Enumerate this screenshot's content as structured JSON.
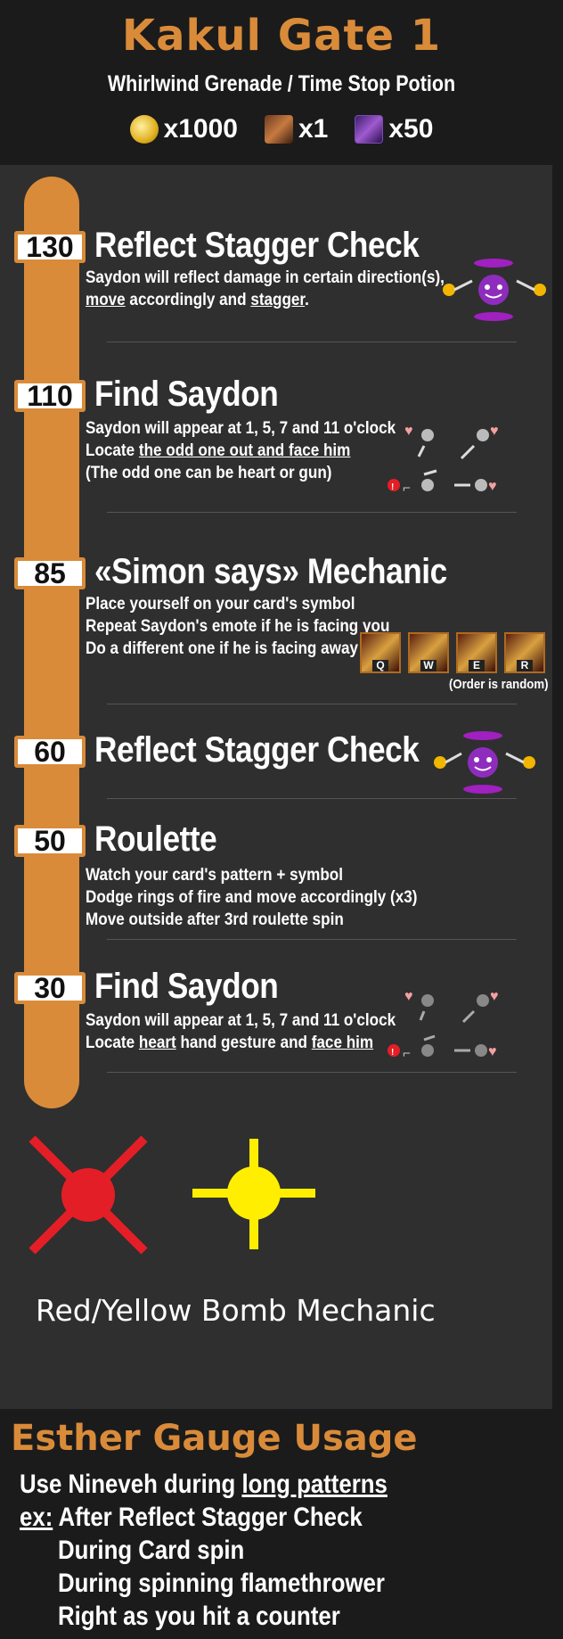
{
  "header": {
    "title": "Kakul Gate 1",
    "subtitle": "Whirlwind Grenade / Time Stop Potion",
    "rewards": [
      {
        "icon": "gold-coin-icon",
        "amount": "x1000"
      },
      {
        "icon": "leapstone-icon",
        "amount": "x1"
      },
      {
        "icon": "chest-icon",
        "amount": "x50"
      }
    ]
  },
  "sections": [
    {
      "hp": "130",
      "title": "Reflect Stagger Check",
      "lines": [
        [
          "Saydon will reflect damage in certain direction(s),"
        ],
        [
          "move",
          " accordingly and ",
          "stagger",
          "."
        ]
      ]
    },
    {
      "hp": "110",
      "title": "Find Saydon",
      "lines": [
        [
          "Saydon will appear at 1, 5, 7 and 11 o'clock"
        ],
        [
          "Locate ",
          "the odd one out and face him"
        ],
        [
          "(The odd one can be heart or gun)"
        ]
      ]
    },
    {
      "hp": "85",
      "title": "«Simon says» Mechanic",
      "lines": [
        [
          "Place yourself on your card's symbol"
        ],
        [
          "Repeat Saydon's emote if he is facing you"
        ],
        [
          "Do a different one if he is facing away"
        ]
      ],
      "emotes": [
        "Q",
        "W",
        "E",
        "R"
      ],
      "note": "(Order is random)"
    },
    {
      "hp": "60",
      "title": "Reflect Stagger Check",
      "lines": []
    },
    {
      "hp": "50",
      "title": "Roulette",
      "lines": [
        [
          "Watch your card's pattern + symbol"
        ],
        [
          "Dodge rings of fire and move accordingly (x3)"
        ],
        [
          "Move outside after 3rd roulette spin"
        ]
      ]
    },
    {
      "hp": "30",
      "title": "Find Saydon",
      "lines": [
        [
          "Saydon will appear at 1, 5, 7 and 11 o'clock"
        ],
        [
          "Locate ",
          "heart",
          " hand gesture and ",
          "face him"
        ]
      ]
    }
  ],
  "bombs": {
    "label": "Red/Yellow Bomb Mechanic",
    "red_color": "#e41e26",
    "yellow_color": "#ffee00"
  },
  "esther": {
    "title": "Esther Gauge Usage",
    "line1_prefix": "Use Nineveh during ",
    "line1_link": "long patterns",
    "line2_prefix": "ex:",
    "line2_rest": " After Reflect Stagger Check",
    "examples": [
      "During Card spin",
      "During spinning flamethrower",
      "Right as you hit a counter"
    ]
  },
  "colors": {
    "accent": "#d98b3a",
    "panel": "#2f2f2f",
    "background": "#1b1b1b"
  }
}
